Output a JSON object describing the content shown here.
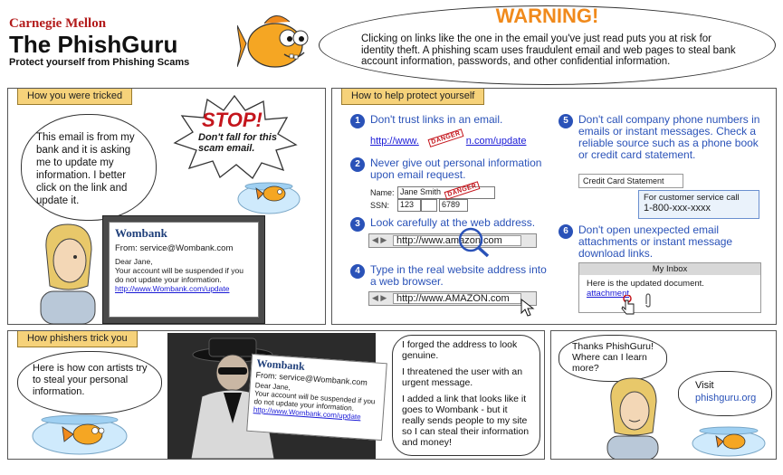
{
  "header": {
    "cmu": "Carnegie Mellon",
    "title": "The PhishGuru",
    "subtitle": "Protect yourself from Phishing Scams"
  },
  "warning": {
    "title": "WARNING!",
    "text": "Clicking on links like the one in the email you've just read puts you at risk for identity theft. A phishing scam uses fraudulent email and web pages to steal bank account information, passwords, and other confidential information."
  },
  "tricked": {
    "tab": "How you were tricked",
    "thought": "This email is from my bank and it is asking me to update my information. I better click on the link and update it.",
    "stop_title": "STOP!",
    "stop_text": "Don't fall for this scam email.",
    "email": {
      "brand": "Wombank",
      "from": "From: service@Wombank.com",
      "greeting": "Dear Jane,",
      "body": "Your account will be suspended if you do not update your information.",
      "link": "http://www.Wombank.com/update"
    }
  },
  "protect": {
    "tab": "How to help protect yourself",
    "tips": [
      {
        "num": "1",
        "text": "Don't trust links in an email."
      },
      {
        "num": "2",
        "text": "Never give out personal information upon email request."
      },
      {
        "num": "3",
        "text": "Look carefully at the web address."
      },
      {
        "num": "4",
        "text": "Type in the real website address into a web browser."
      },
      {
        "num": "5",
        "text": "Don't call company phone numbers in emails or instant messages. Check a reliable source such as a phone book or credit card statement."
      },
      {
        "num": "6",
        "text": "Don't open unexpected email attachments or instant message download links."
      }
    ],
    "tip1_link": "http://www.",
    "tip1_link_end": "n.com/update",
    "danger": "DANGER",
    "form": {
      "name_label": "Name:",
      "name_value": "Jane Smith",
      "ssn_label": "SSN:",
      "ssn_part1": "123",
      "ssn_part3": "6789"
    },
    "addr3": "http://www.amazon.com",
    "addr4": "http://www.AMAZON.com",
    "cc": {
      "title": "Credit Card Statement",
      "line1": "For customer service call",
      "phone": "1-800-xxx-xxxx"
    },
    "inbox": {
      "title": "My Inbox",
      "body": "Here is the updated document.",
      "attachment": "attachment"
    }
  },
  "phishers": {
    "tab": "How phishers trick you",
    "bubble": "Here is how con artists try to steal your personal information.",
    "email": {
      "brand": "Wombank",
      "from": "From: service@Wombank.com",
      "greeting": "Dear Jane,",
      "body": "Your account will be suspended if you do not update your information.",
      "link": "http://www.Wombank.com/update"
    },
    "confession": [
      "I forged the address to look genuine.",
      "I threatened the user with an urgent message.",
      "I added a link that looks like it goes to Wombank - but it really sends people to my site so I can steal their information and money!"
    ]
  },
  "thanks": {
    "question": "Thanks PhishGuru! Where can I learn more?",
    "visit": "Visit",
    "site": "phishguru.org"
  },
  "colors": {
    "accent_blue": "#2a52b8",
    "warning_orange": "#f08a1c",
    "tab_yellow": "#f6d27a",
    "cmu_red": "#b31b1b"
  }
}
